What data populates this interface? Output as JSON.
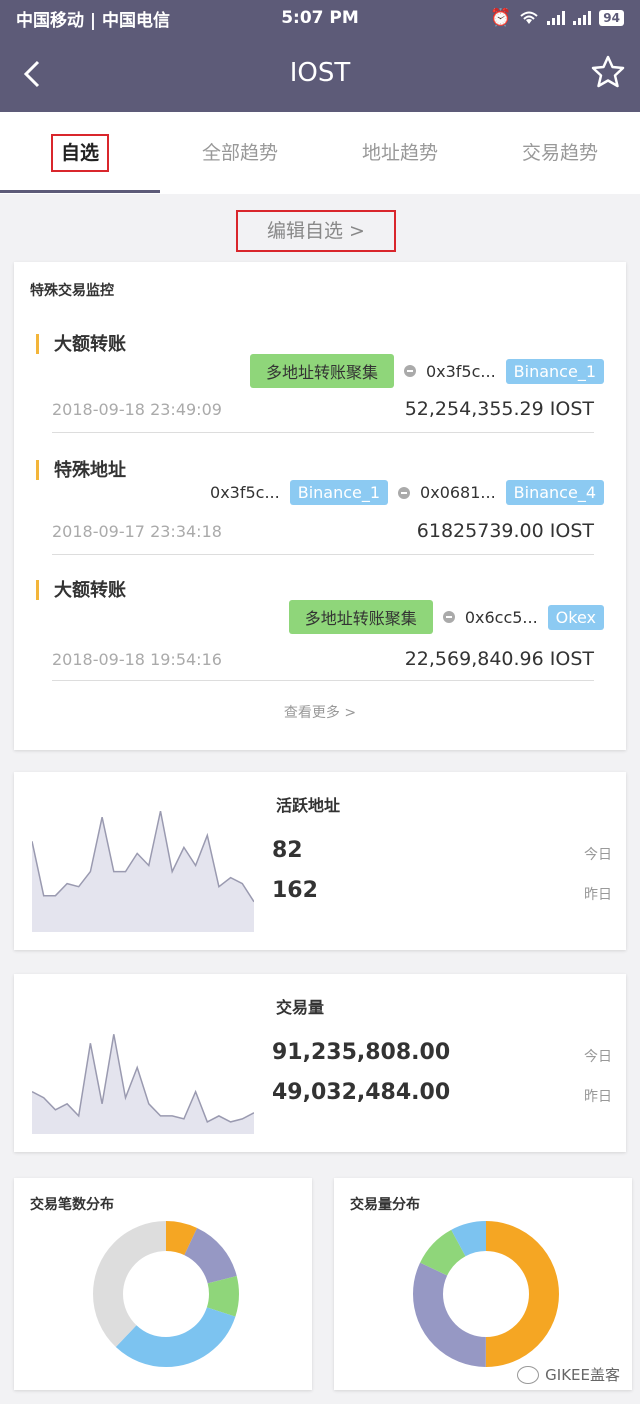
{
  "status_bar": {
    "carriers": "中国移动 | 中国电信",
    "time": "5:07 PM",
    "battery": "94"
  },
  "header": {
    "title": "IOST",
    "back_icon": "back-arrow-icon",
    "star_icon": "star-icon"
  },
  "tabs": [
    {
      "label": "自选",
      "active": true
    },
    {
      "label": "全部趋势",
      "active": false
    },
    {
      "label": "地址趋势",
      "active": false
    },
    {
      "label": "交易趋势",
      "active": false
    }
  ],
  "edit_watchlist": "编辑自选 >",
  "monitor": {
    "title": "特殊交易监控",
    "more": "查看更多 >",
    "entries": [
      {
        "type": "大额转账",
        "from_tag": "多地址转账聚集",
        "to_addr": "0x3f5c...",
        "to_label": "Binance_1",
        "time": "2018-09-18 23:49:09",
        "amount": "52,254,355.29 IOST"
      },
      {
        "type": "特殊地址",
        "from_addr": "0x3f5c...",
        "from_label": "Binance_1",
        "to_addr": "0x0681...",
        "to_label": "Binance_4",
        "time": "2018-09-17 23:34:18",
        "amount": "61825739.00 IOST"
      },
      {
        "type": "大额转账",
        "from_tag": "多地址转账聚集",
        "to_addr": "0x6cc5...",
        "to_label": "Okex",
        "time": "2018-09-18 19:54:16",
        "amount": "22,569,840.96 IOST"
      }
    ]
  },
  "active_addresses": {
    "title": "活跃地址",
    "today": "82",
    "yesterday": "162",
    "today_label": "今日",
    "yesterday_label": "昨日"
  },
  "volume": {
    "title": "交易量",
    "today": "91,235,808.00",
    "yesterday": "49,032,484.00",
    "today_label": "今日",
    "yesterday_label": "昨日"
  },
  "tx_count_dist": {
    "title": "交易笔数分布"
  },
  "volume_dist": {
    "title": "交易量分布"
  },
  "watermark": "GIKEE盖客",
  "chart_data": [
    {
      "type": "area",
      "series": [
        {
          "values": [
            30,
            12,
            12,
            16,
            15,
            20,
            38,
            20,
            20,
            26,
            22,
            40,
            20,
            28,
            22,
            32,
            15,
            18,
            16,
            10
          ]
        }
      ]
    },
    {
      "type": "area",
      "series": [
        {
          "values": [
            14,
            12,
            8,
            10,
            6,
            30,
            10,
            33,
            12,
            22,
            10,
            6,
            6,
            5,
            14,
            4,
            6,
            4,
            5,
            7
          ]
        }
      ]
    },
    {
      "type": "pie",
      "series": [
        {
          "values": [
            7,
            14,
            9,
            32,
            38
          ]
        }
      ],
      "colors": [
        "#f5a623",
        "#9698c4",
        "#8fd67a",
        "#7cc3f0",
        "#dddddd"
      ]
    },
    {
      "type": "pie",
      "series": [
        {
          "values": [
            50,
            32,
            10,
            8
          ]
        }
      ],
      "colors": [
        "#f5a623",
        "#9698c4",
        "#8fd67a",
        "#7cc3f0"
      ]
    }
  ]
}
